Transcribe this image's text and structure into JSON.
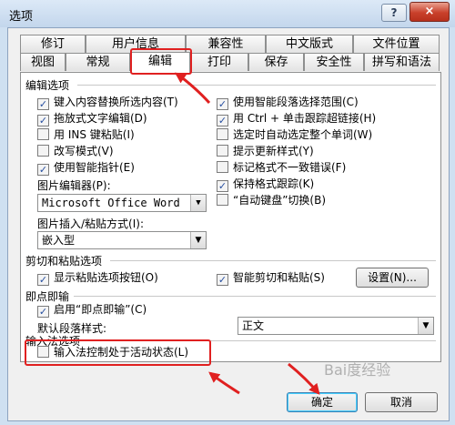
{
  "window": {
    "title": "选项",
    "help": "?",
    "close": "×"
  },
  "tabs_back": [
    "修订",
    "用户信息",
    "兼容性",
    "中文版式",
    "文件位置"
  ],
  "tabs_front": [
    "视图",
    "常规",
    "编辑",
    "打印",
    "保存",
    "安全性",
    "拼写和语法"
  ],
  "active_tab": "编辑",
  "edit_options": {
    "section_title": "编辑选项",
    "left": [
      {
        "label": "键入内容替换所选内容(T)",
        "checked": true
      },
      {
        "label": "拖放式文字编辑(D)",
        "checked": true
      },
      {
        "label": "用 INS 键粘贴(I)",
        "checked": false
      },
      {
        "label": "改写模式(V)",
        "checked": false
      },
      {
        "label": "使用智能指针(E)",
        "checked": true
      }
    ],
    "right": [
      {
        "label": "使用智能段落选择范围(C)",
        "checked": true
      },
      {
        "label": "用 Ctrl + 单击跟踪超链接(H)",
        "checked": true
      },
      {
        "label": "选定时自动选定整个单词(W)",
        "checked": false
      },
      {
        "label": "提示更新样式(Y)",
        "checked": false
      },
      {
        "label": "标记格式不一致错误(F)",
        "checked": false
      },
      {
        "label": "保持格式跟踪(K)",
        "checked": true
      },
      {
        "label": "“自动键盘”切换(B)",
        "checked": false
      }
    ],
    "picture_editor_label": "图片编辑器(P):",
    "picture_editor_value": "Microsoft Office Word",
    "insert_paste_label": "图片插入/粘贴方式(I):",
    "insert_paste_value": "嵌入型"
  },
  "cut_paste": {
    "section_title": "剪切和粘贴选项",
    "show_paste_buttons": {
      "label": "显示粘贴选项按钮(O)",
      "checked": true
    },
    "smart_cut_paste": {
      "label": "智能剪切和粘贴(S)",
      "checked": true
    },
    "settings_button": "设置(N)..."
  },
  "click_and_type": {
    "section_title": "即点即输",
    "enable": {
      "label": "启用“即点即输”(C)",
      "checked": true
    },
    "default_style_label": "默认段落样式:",
    "default_style_value": "正文"
  },
  "ime": {
    "section_title": "输入法选项",
    "ime_control": {
      "label": "输入法控制处于活动状态(L)",
      "checked": false
    }
  },
  "buttons": {
    "ok": "确定",
    "cancel": "取消"
  },
  "watermark": "Bai度经验",
  "annotation_color": "#e02020"
}
